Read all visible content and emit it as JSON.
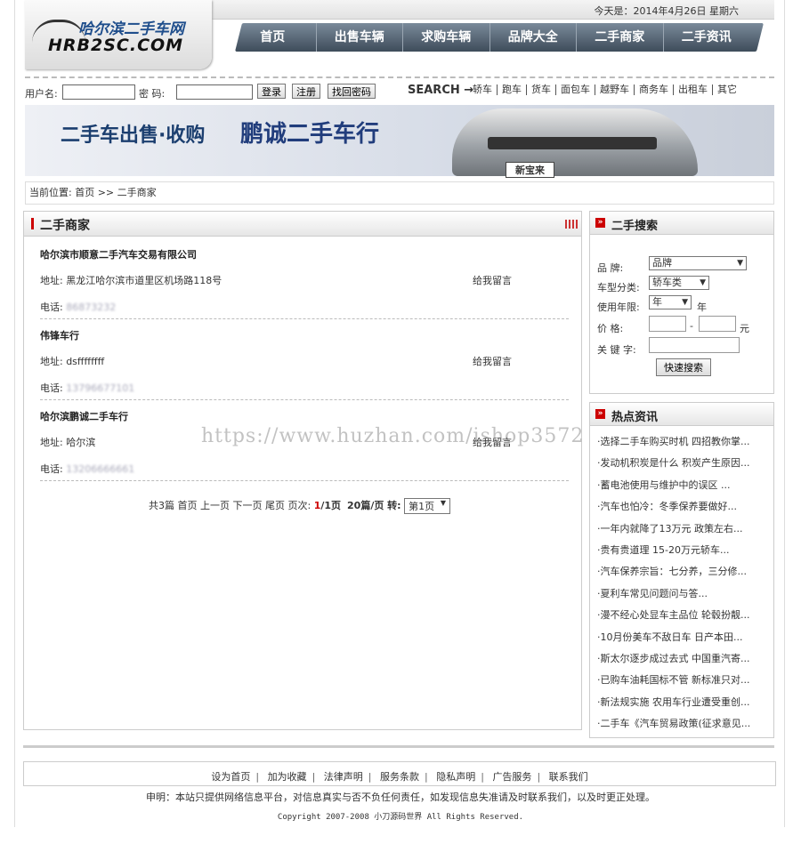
{
  "header": {
    "date": "今天是：2014年4月26日 星期六",
    "logo_cn": "哈尔滨二手车网",
    "logo_en": "HRB2SC.COM",
    "nav": [
      "首页",
      "出售车辆",
      "求购车辆",
      "品牌大全",
      "二手商家",
      "二手资讯"
    ]
  },
  "login": {
    "username_label": "用户名:",
    "password_label": "密  码:",
    "login_btn": "登录",
    "register_btn": "注册",
    "forgot_btn": "找回密码",
    "search_title": "SEARCH →",
    "categories": [
      "轿车",
      "跑车",
      "货车",
      "面包车",
      "越野车",
      "商务车",
      "出租车",
      "其它"
    ]
  },
  "banner": {
    "text1": "二手车出售·收购",
    "text2": "鹏诚二手车行",
    "badge": "新宝来"
  },
  "breadcrumb": "当前位置: 首页 >> 二手商家",
  "main": {
    "title": "二手商家",
    "dealers": [
      {
        "name": "哈尔滨市顺意二手汽车交易有限公司",
        "address": "地址: 黑龙江哈尔滨市道里区机场路118号",
        "phone_label": "电话:",
        "phone": "86873232",
        "msg": "给我留言"
      },
      {
        "name": "伟锋车行",
        "address": "地址: dsffffffff",
        "phone_label": "电话:",
        "phone": "13796677101",
        "msg": "给我留言"
      },
      {
        "name": "哈尔滨鹏诚二手车行",
        "address": "地址: 哈尔滨",
        "phone_label": "电话:",
        "phone": "13206666661",
        "msg": "给我留言"
      }
    ],
    "pager": {
      "prefix": "共3篇 首页 上一页 下一页 尾页 页次:",
      "current": "1",
      "total": "/1页",
      "per_page": "20篇/页 转:",
      "select": "第1页"
    }
  },
  "search_panel": {
    "title": "二手搜索",
    "brand_label": "品    牌:",
    "brand_value": "品牌",
    "type_label": "车型分类:",
    "type_value": "轿车类",
    "years_label": "使用年限:",
    "years_value": "年",
    "years_unit": "年",
    "price_label": "价    格:",
    "price_sep": "-",
    "price_unit": "元",
    "keyword_label": "关 键 字:",
    "submit": "快速搜索"
  },
  "hot_panel": {
    "title": "热点资讯",
    "items": [
      "·选择二手车购买时机 四招教你掌...",
      "·发动机积炭是什么 积炭产生原因...",
      "·蓄电池使用与维护中的误区 ...",
      "·汽车也怕冷：冬季保养要做好...",
      "·一年内就降了13万元 政策左右...",
      "·贵有贵道理 15-20万元轿车...",
      "·汽车保养宗旨：七分养，三分修...",
      "·夏利车常见问题问与答...",
      "·漫不经心处显车主品位 轮毂扮靓...",
      "·10月份美车不敌日车 日产本田...",
      "·斯太尔逐步成过去式 中国重汽寄...",
      "·已购车油耗国标不管 新标准只对...",
      "·新法规实施 农用车行业遭受重创...",
      "·二手车《汽车贸易政策(征求意见..."
    ]
  },
  "footer": {
    "links": [
      "设为首页",
      "加为收藏",
      "法律声明",
      "服务条款",
      "隐私声明",
      "广告服务",
      "联系我们"
    ],
    "note": "申明：本站只提供网络信息平台，对信息真实与否不负任何责任，如发现信息失准请及时联系我们，以及时更正处理。",
    "copyright": "Copyright 2007-2008 小刀源码世界 All Rights Reserved."
  },
  "watermark": "https://www.huzhan.com/ishop3572"
}
